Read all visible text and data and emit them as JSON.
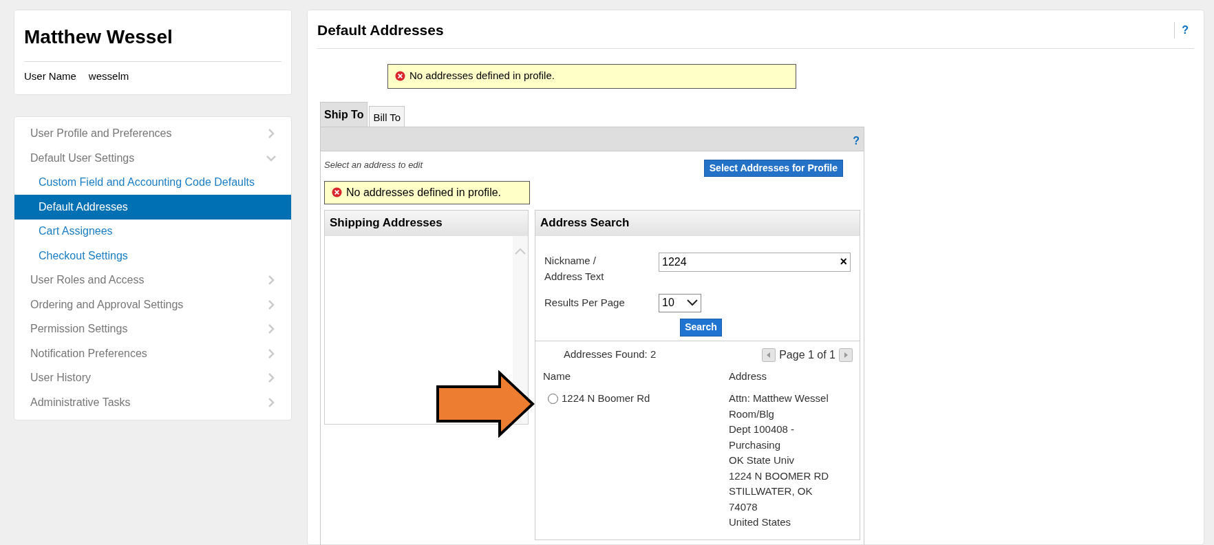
{
  "profile": {
    "name": "Matthew Wessel",
    "user_name_label": "User Name",
    "user_name": "wesselm"
  },
  "nav": [
    {
      "label": "User Profile and Preferences",
      "expanded": false,
      "selected": false
    },
    {
      "label": "Default User Settings",
      "expanded": true,
      "selected": false,
      "children": [
        {
          "label": "Custom Field and Accounting Code Defaults",
          "selected": false
        },
        {
          "label": "Default Addresses",
          "selected": true
        },
        {
          "label": "Cart Assignees",
          "selected": false
        },
        {
          "label": "Checkout Settings",
          "selected": false
        }
      ]
    },
    {
      "label": "User Roles and Access",
      "expanded": false,
      "selected": false
    },
    {
      "label": "Ordering and Approval Settings",
      "expanded": false,
      "selected": false
    },
    {
      "label": "Permission Settings",
      "expanded": false,
      "selected": false
    },
    {
      "label": "Notification Preferences",
      "expanded": false,
      "selected": false
    },
    {
      "label": "User History",
      "expanded": false,
      "selected": false
    },
    {
      "label": "Administrative Tasks",
      "expanded": false,
      "selected": false
    }
  ],
  "page": {
    "title": "Default Addresses",
    "help": "?",
    "alert": "No addresses defined in profile."
  },
  "tabs": [
    {
      "label": "Ship To",
      "selected": true
    },
    {
      "label": "Bill To",
      "selected": false
    }
  ],
  "tab_panel": {
    "help": "?",
    "hint": "Select an address to edit",
    "select_button": "Select Addresses for Profile",
    "alert": "No addresses defined in profile."
  },
  "shipping_addresses": {
    "title": "Shipping Addresses"
  },
  "address_search": {
    "title": "Address Search",
    "nickname_label": "Nickname / Address Text",
    "nickname_value": "1224",
    "clear": "×",
    "results_label": "Results Per Page",
    "results_value": "10",
    "search_button": "Search",
    "found": "Addresses Found: 2",
    "pager": "Page 1 of 1",
    "columns": [
      "Name",
      "Address"
    ],
    "rows": [
      {
        "name": "1224 N Boomer Rd",
        "selected": false,
        "address": [
          "Attn: Matthew Wessel",
          "Room/Blg",
          "Dept 100408 -",
          "Purchasing",
          "OK State Univ",
          "1224 N BOOMER RD",
          "STILLWATER, OK",
          "74078",
          "United States"
        ]
      }
    ]
  }
}
